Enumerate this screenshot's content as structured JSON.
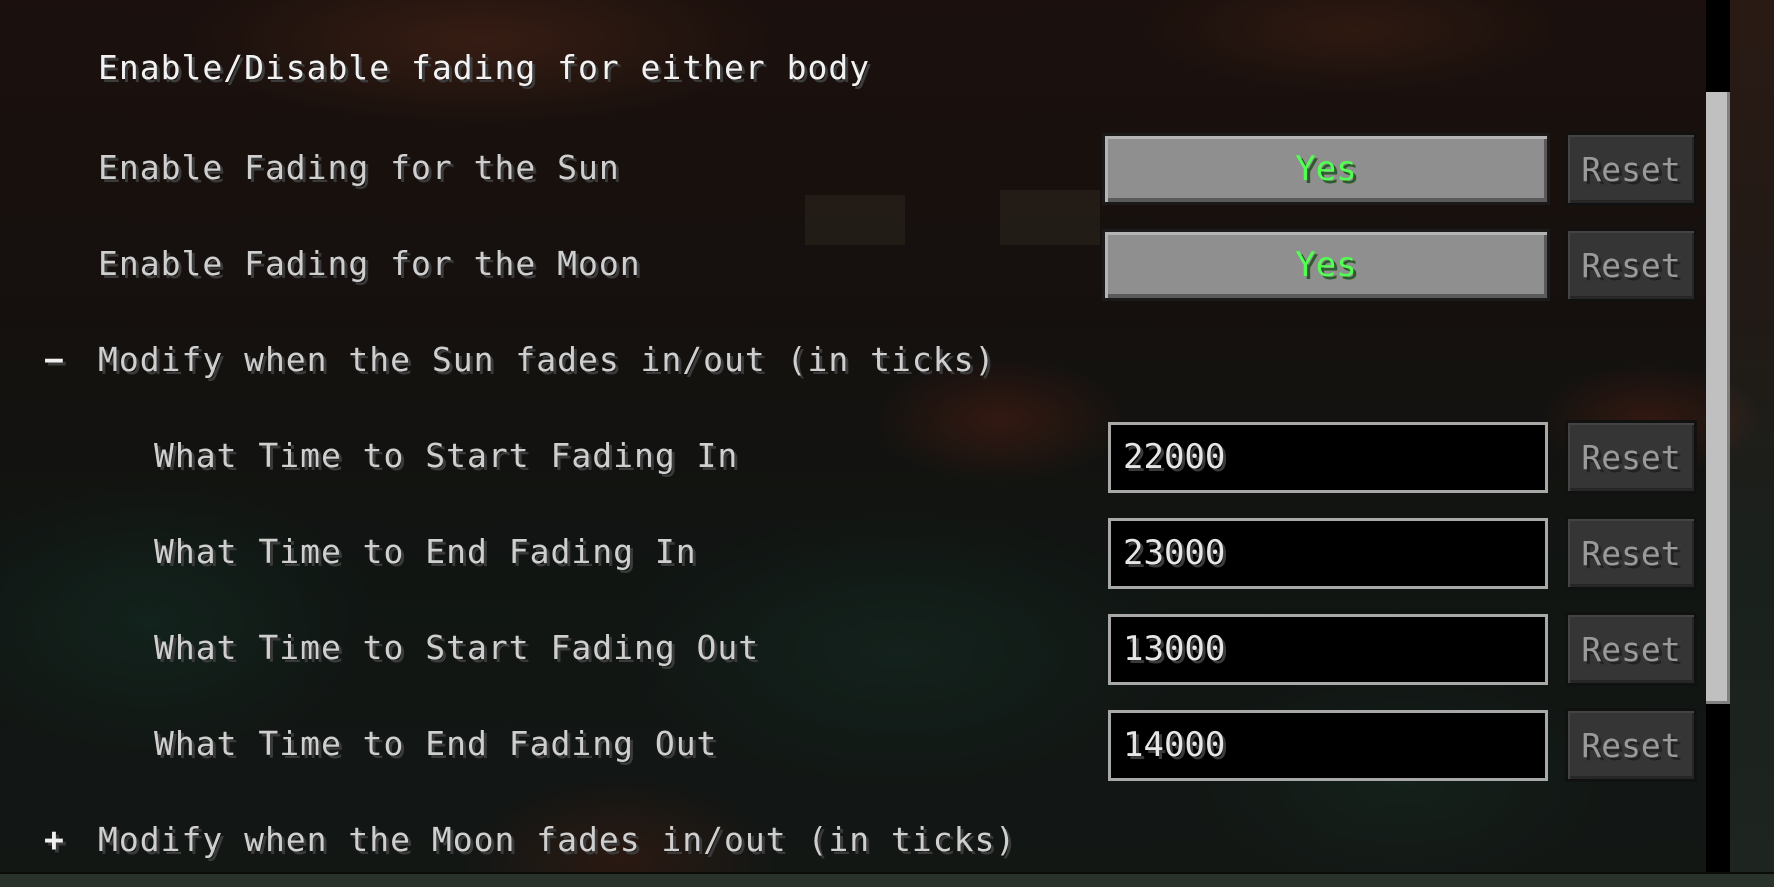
{
  "config_list": {
    "section_fading": {
      "title": "Enable/Disable fading for either body"
    },
    "entries": [
      {
        "label": "Enable Fading for the Sun",
        "value": "Yes",
        "reset": "Reset"
      },
      {
        "label": "Enable Fading for the Moon",
        "value": "Yes",
        "reset": "Reset"
      }
    ],
    "sun_group": {
      "toggle": "−",
      "title": "Modify when the Sun fades in/out (in ticks)",
      "fields": [
        {
          "label": "What Time to Start Fading In",
          "value": "22000",
          "reset": "Reset"
        },
        {
          "label": "What Time to End Fading In",
          "value": "23000",
          "reset": "Reset"
        },
        {
          "label": "What Time to Start Fading Out",
          "value": "13000",
          "reset": "Reset"
        },
        {
          "label": "What Time to End Fading Out",
          "value": "14000",
          "reset": "Reset"
        }
      ]
    },
    "moon_group": {
      "toggle": "+",
      "title": "Modify when the Moon fades in/out (in ticks)"
    }
  },
  "colors": {
    "toggle_on_text": "#52ff52",
    "button_face": "#8f8f8f",
    "reset_disabled_face": "#353535",
    "text_field_background": "#000000",
    "scrollbar_thumb": "#c0c0c0"
  }
}
